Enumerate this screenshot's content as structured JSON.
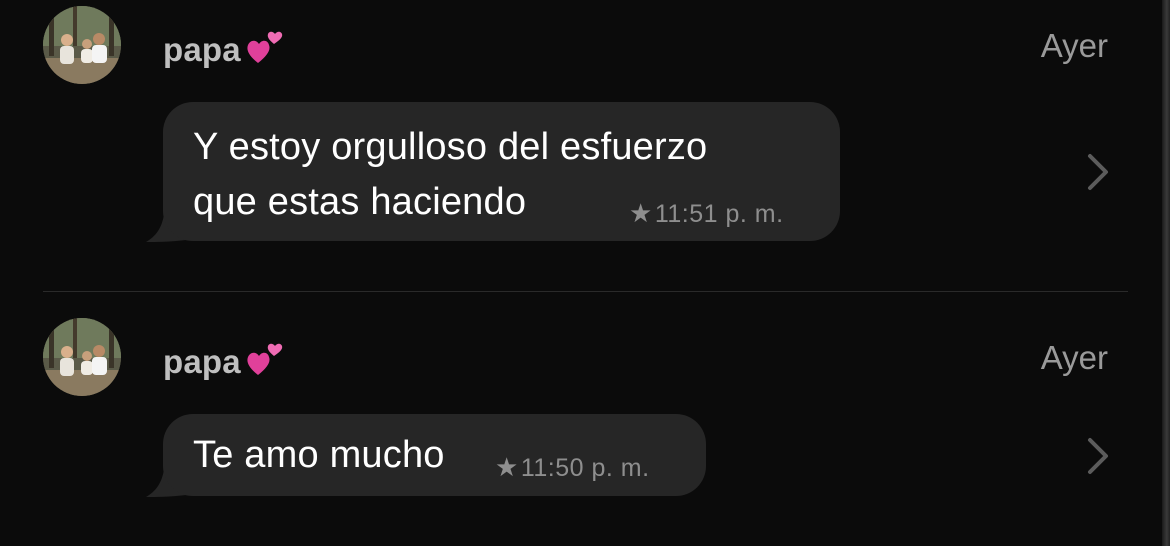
{
  "colors": {
    "background": "#0b0b0b",
    "bubble": "#262626",
    "sender_text": "#bfbfbf",
    "meta_text": "#8e8e8e",
    "heart": "#e0409a"
  },
  "messages": [
    {
      "sender": "papa",
      "sender_emoji": "two-hearts-icon",
      "date": "Ayer",
      "text_lines": [
        "Y estoy orgulloso del esfuerzo",
        "que estas haciendo"
      ],
      "starred": true,
      "time": "11:51",
      "ampm": "p. m."
    },
    {
      "sender": "papa",
      "sender_emoji": "two-hearts-icon",
      "date": "Ayer",
      "text_lines": [
        "Te amo mucho"
      ],
      "starred": true,
      "time": "11:50",
      "ampm": "p. m."
    }
  ]
}
